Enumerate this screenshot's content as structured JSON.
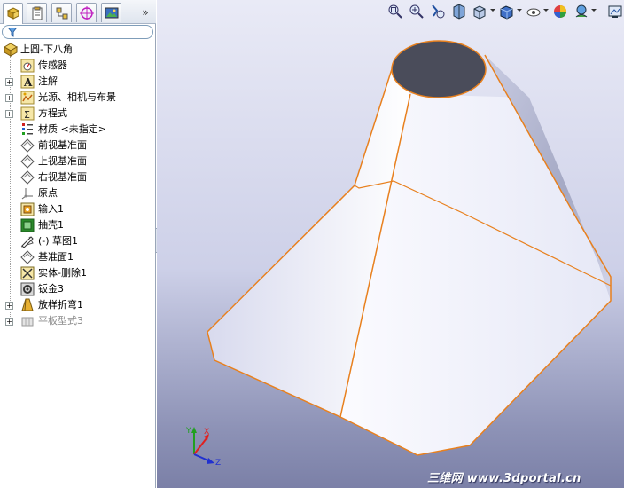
{
  "feature_tree": {
    "root": "上圆-下八角",
    "items": [
      {
        "label": "传感器",
        "icon": "sensor-icon",
        "expandable": false,
        "disabled": false
      },
      {
        "label": "注解",
        "icon": "annotation-icon",
        "expandable": true,
        "disabled": false
      },
      {
        "label": "光源、相机与布景",
        "icon": "lights-cameras-scene-icon",
        "expandable": true,
        "disabled": false
      },
      {
        "label": "方程式",
        "icon": "equations-icon",
        "expandable": true,
        "disabled": false
      },
      {
        "label": "材质 <未指定>",
        "icon": "material-icon",
        "expandable": false,
        "disabled": false
      },
      {
        "label": "前视基准面",
        "icon": "plane-icon",
        "expandable": false,
        "disabled": false
      },
      {
        "label": "上视基准面",
        "icon": "plane-icon",
        "expandable": false,
        "disabled": false
      },
      {
        "label": "右视基准面",
        "icon": "plane-icon",
        "expandable": false,
        "disabled": false
      },
      {
        "label": "原点",
        "icon": "origin-icon",
        "expandable": false,
        "disabled": false
      },
      {
        "label": "输入1",
        "icon": "import-icon",
        "expandable": false,
        "disabled": false
      },
      {
        "label": "抽壳1",
        "icon": "shell-icon",
        "expandable": false,
        "disabled": false
      },
      {
        "label": "(-) 草图1",
        "icon": "sketch-icon",
        "expandable": false,
        "disabled": false
      },
      {
        "label": "基准面1",
        "icon": "plane-icon",
        "expandable": false,
        "disabled": false
      },
      {
        "label": "实体-删除1",
        "icon": "delete-body-icon",
        "expandable": false,
        "disabled": false
      },
      {
        "label": "钣金3",
        "icon": "sheet-metal-icon",
        "expandable": false,
        "disabled": false
      },
      {
        "label": "放样折弯1",
        "icon": "lofted-bend-icon",
        "expandable": true,
        "disabled": false
      },
      {
        "label": "平板型式3",
        "icon": "flat-pattern-icon",
        "expandable": true,
        "disabled": true
      }
    ]
  },
  "panel_tabs": [
    {
      "name": "feature-manager-tab",
      "icon": "feature-manager-icon"
    },
    {
      "name": "property-manager-tab",
      "icon": "property-manager-icon"
    },
    {
      "name": "configuration-manager-tab",
      "icon": "configuration-manager-icon"
    },
    {
      "name": "dimxpert-manager-tab",
      "icon": "dimxpert-icon"
    },
    {
      "name": "display-manager-tab",
      "icon": "display-manager-icon"
    }
  ],
  "tab_overflow_label": "»",
  "view_toolbar": [
    "zoom-to-fit-icon",
    "zoom-to-area-icon",
    "previous-view-icon",
    "section-view-icon",
    "view-orientation-icon",
    "display-style-icon",
    "hide-show-items-icon",
    "edit-appearance-icon",
    "apply-scene-icon",
    "view-settings-icon"
  ],
  "triad": {
    "x": "X",
    "y": "Y",
    "z": "Z"
  },
  "watermark": "三维网 www.3dportal.cn",
  "colors": {
    "edge_highlight": "#e8801e",
    "face_light": "#f2f3fb",
    "face_shadow": "#a9adc8",
    "viewport_top": "#e9eaf6",
    "viewport_bottom": "#7b80a7"
  }
}
